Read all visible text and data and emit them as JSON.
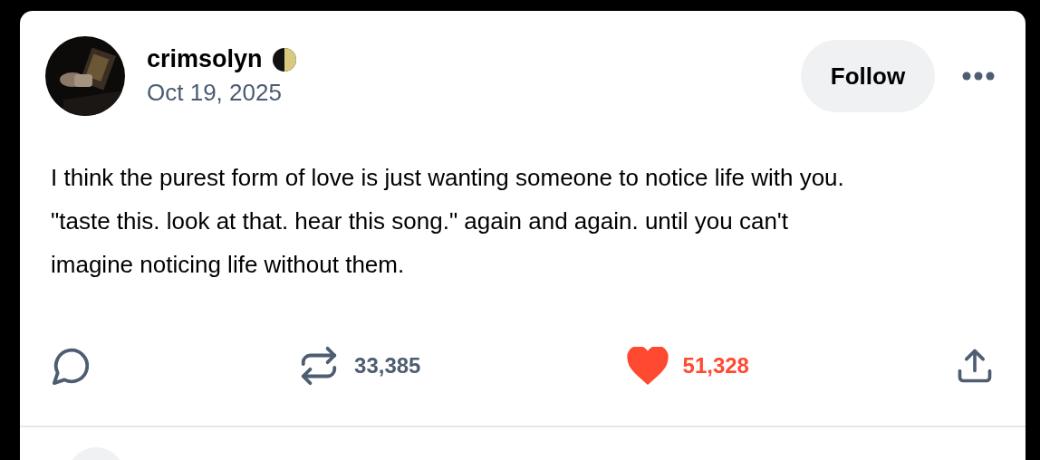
{
  "post": {
    "author": {
      "name": "crimsolyn",
      "date": "Oct 19, 2025"
    },
    "follow_button": "Follow",
    "text": "I think the purest form of love is just wanting someone to notice life with you. \"taste this. look at that. hear this song.\" again and again. until you can't imagine noticing life without them.",
    "actions": {
      "reblogs": "33,385",
      "likes": "51,328",
      "liked": true
    }
  }
}
